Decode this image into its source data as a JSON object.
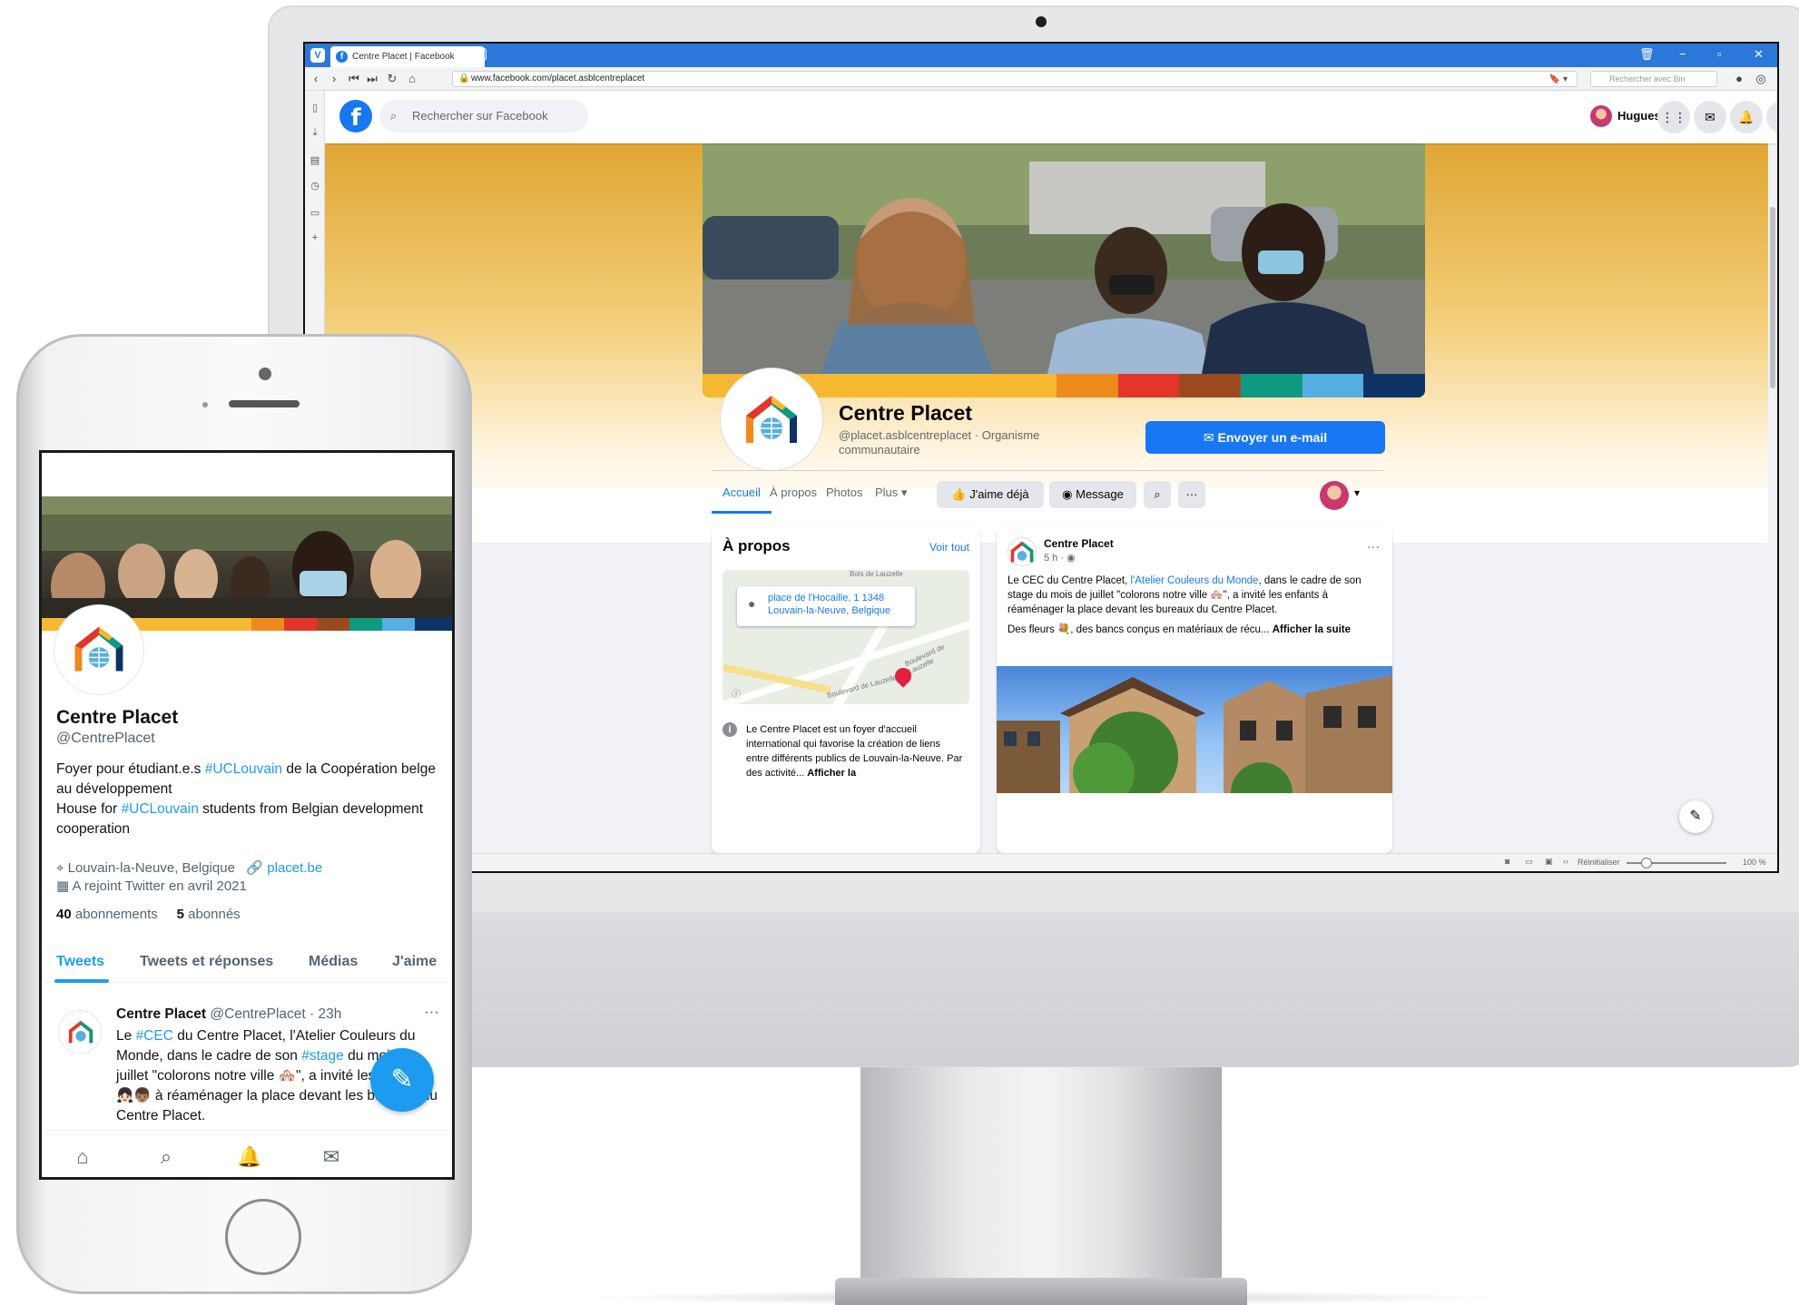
{
  "browser": {
    "tab_title": "Centre Placet | Facebook",
    "url": "www.facebook.com/placet.asblcentreplacet",
    "search_placeholder": "Rechercher avec Bin",
    "status_reset": "Réinitialiser",
    "zoom": "100 %"
  },
  "facebook": {
    "search_placeholder": "Rechercher sur Facebook",
    "user_name": "Hugues",
    "page_name": "Centre Placet",
    "page_handle": "@placet.asblcentreplacet · Organisme communautaire",
    "email_button": "✉ Envoyer un e-mail",
    "tabs": [
      "Accueil",
      "À propos",
      "Photos",
      "Plus ▾"
    ],
    "like_button": "J'aime déjà",
    "message_button": "Message",
    "about": {
      "title": "À propos",
      "see_all": "Voir tout",
      "address_line1": "place de l'Hocaille, 1 1348",
      "address_line2": "Louvain-la-Neuve, Belgique",
      "map_label_top": "Bois de Lauzelle",
      "map_label_road": "Boulevard de Lauzelle",
      "map_label_road2": "Boulevard de Lauzelle",
      "description": "Le Centre Placet est un foyer d'accueil international qui favorise la création de liens entre différents publics de Louvain-la-Neuve. Par des activité...",
      "description_more": "Afficher la"
    },
    "post": {
      "author": "Centre Placet",
      "time": "5 h · ◉",
      "text_part1": "Le CEC du Centre Placet, ",
      "text_link": "l'Atelier Couleurs du Monde",
      "text_part2": ", dans le cadre de son stage du mois de juillet \"colorons notre ville 🏘️\", a invité les enfants à réaménager la place devant les bureaux du Centre Placet.",
      "text_line2": "Des fleurs 💐, des bancs conçus en matériaux de récu...",
      "text_more": "Afficher la suite"
    }
  },
  "twitter": {
    "name": "Centre Placet",
    "handle": "@CentrePlacet",
    "bio_1": "Foyer pour étudiant.e.s ",
    "bio_ht1": "#UCLouvain",
    "bio_2": " de la Coopération belge au développement",
    "bio_3": "House for ",
    "bio_ht2": "#UCLouvain",
    "bio_4": " students from Belgian development cooperation",
    "location": "Louvain-la-Neuve, Belgique",
    "website": "placet.be",
    "joined": "A rejoint Twitter en avril 2021",
    "following_count": "40",
    "following_label": "abonnements",
    "followers_count": "5",
    "followers_label": "abonnés",
    "tabs": [
      "Tweets",
      "Tweets et réponses",
      "Médias",
      "J'aime"
    ],
    "tweet": {
      "author": "Centre Placet",
      "meta": "@CentrePlacet · 23h",
      "t1": "Le ",
      "ht1": "#CEC",
      "t2": " du Centre Placet, l'Atelier Couleurs du Monde, dans le cadre de son ",
      "ht2": "#stage",
      "t3": " du mois de juillet \"colorons notre ville 🏘️\", a invité les enfants 👧🏻👦🏽 à réaménager la place devant les bureaux du Centre Placet."
    }
  },
  "colors": {
    "facebook_blue": "#1877f2",
    "twitter_blue": "#1d9bf0",
    "brand_bar": [
      "#f6b731",
      "#ee8a1c",
      "#e4352b",
      "#9a4a1e",
      "#0e9a7e",
      "#56aee2",
      "#0e3366"
    ]
  }
}
